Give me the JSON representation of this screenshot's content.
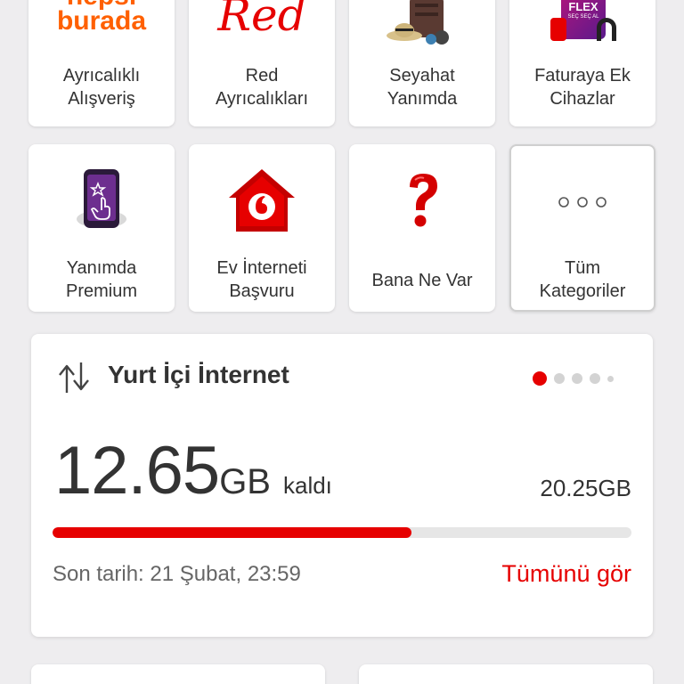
{
  "tiles_row1": [
    {
      "logo_line1": "hepsi",
      "logo_line2": "burada",
      "line1": "Ayrıcalıklı",
      "line2": "Alışveriş"
    },
    {
      "logo": "Red",
      "line1": "Red",
      "line2": "Ayrıcalıkları"
    },
    {
      "icon": "travel-luggage-icon",
      "line1": "Seyahat",
      "line2": "Yanımda"
    },
    {
      "logo_top": "FLEX",
      "logo_sub": "SEÇ SEÇ AL",
      "line1": "Faturaya Ek",
      "line2": "Cihazlar"
    }
  ],
  "tiles_row2": [
    {
      "icon": "phone-star-icon",
      "line1": "Yanımda",
      "line2": "Premium"
    },
    {
      "icon": "vodafone-house-icon",
      "line1": "Ev İnterneti",
      "line2": "Başvuru"
    },
    {
      "icon": "question-mark-icon",
      "line1": "Bana Ne Var"
    },
    {
      "icon": "more-dots-icon",
      "line1": "Tüm",
      "line2": "Kategoriler"
    }
  ],
  "usage_card": {
    "title": "Yurt İçi İnternet",
    "remaining_value": "12.65",
    "remaining_unit": "GB",
    "remaining_word": "kaldı",
    "total": "20.25GB",
    "progress": 0.62,
    "deadline": "Son tarih: 21 Şubat, 23:59",
    "see_all": "Tümünü gör",
    "pager_dots": 5,
    "active_dot": 0
  },
  "colors": {
    "accent": "#e60000",
    "hepsiburada_orange": "#ff6000",
    "background": "#eeedef"
  }
}
